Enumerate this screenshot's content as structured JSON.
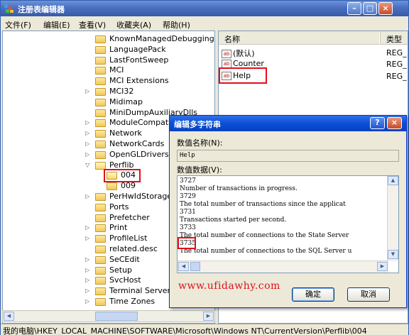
{
  "window": {
    "title": "注册表编辑器",
    "controls": {
      "minimize": "–",
      "maximize": "□",
      "close": "×"
    }
  },
  "menu": [
    "文件(F)",
    "编辑(E)",
    "查看(V)",
    "收藏夹(A)",
    "帮助(H)"
  ],
  "tree": {
    "items": [
      {
        "label": "KnownManagedDebugging",
        "expandable": false
      },
      {
        "label": "LanguagePack",
        "expandable": false
      },
      {
        "label": "LastFontSweep",
        "expandable": false
      },
      {
        "label": "MCI",
        "expandable": false
      },
      {
        "label": "MCI Extensions",
        "expandable": false
      },
      {
        "label": "MCI32",
        "expandable": true
      },
      {
        "label": "Midimap",
        "expandable": false
      },
      {
        "label": "MiniDumpAuxiliaryDlls",
        "expandable": false
      },
      {
        "label": "ModuleCompatibility",
        "expandable": true
      },
      {
        "label": "Network",
        "expandable": true
      },
      {
        "label": "NetworkCards",
        "expandable": true
      },
      {
        "label": "OpenGLDrivers",
        "expandable": true
      },
      {
        "label": "Perflib",
        "expandable": true,
        "expanded": true
      },
      {
        "label": "004",
        "indent": 1,
        "selected": true
      },
      {
        "label": "009",
        "indent": 1
      },
      {
        "label": "PerHwIdStorage",
        "expandable": true
      },
      {
        "label": "Ports",
        "expandable": false
      },
      {
        "label": "Prefetcher",
        "expandable": false
      },
      {
        "label": "Print",
        "expandable": true
      },
      {
        "label": "ProfileList",
        "expandable": true
      },
      {
        "label": "related.desc",
        "expandable": false
      },
      {
        "label": "SeCEdit",
        "expandable": true
      },
      {
        "label": "Setup",
        "expandable": true
      },
      {
        "label": "SvcHost",
        "expandable": true
      },
      {
        "label": "Terminal Server",
        "expandable": true
      },
      {
        "label": "Time Zones",
        "expandable": true
      }
    ]
  },
  "list": {
    "columns": [
      "名称",
      "类型"
    ],
    "rows": [
      {
        "name": "(默认)",
        "type": "REG_"
      },
      {
        "name": "Counter",
        "type": "REG_"
      },
      {
        "name": "Help",
        "type": "REG_"
      }
    ]
  },
  "status_bar": "我的电脑\\HKEY_LOCAL_MACHINE\\SOFTWARE\\Microsoft\\Windows NT\\CurrentVersion\\Perflib\\004",
  "dialog": {
    "title": "编辑多字符串",
    "help_btn": "?",
    "close_btn": "×",
    "name_label": "数值名称(N):",
    "name_value": "Help",
    "data_label": "数值数据(V):",
    "data_lines": [
      "3727",
      "Number of transactions in progress.",
      "3729",
      "The total number of transactions since the applicat",
      "3731",
      "Transactions started per second.",
      "3733",
      "The total number of connections to the State Server",
      "3735",
      "The total number of connections to the SQL Server u"
    ],
    "ok_label": "确定",
    "cancel_label": "取消",
    "watermark": "www.ufidawhy.com"
  }
}
